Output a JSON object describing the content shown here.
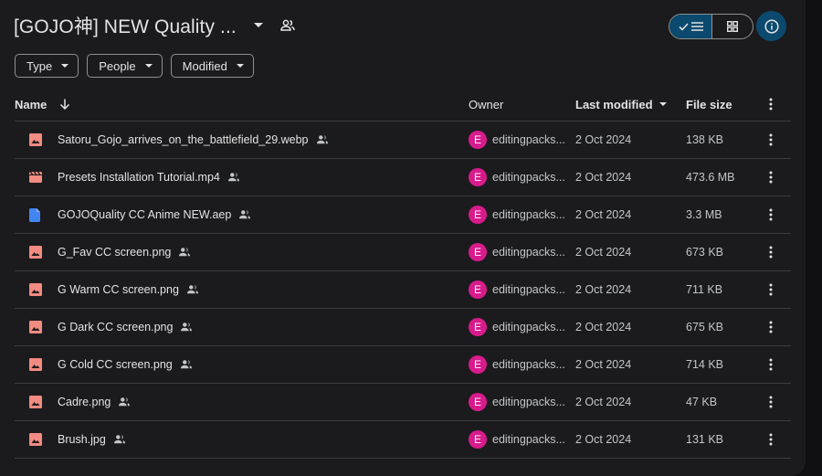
{
  "header": {
    "title": "[GOJO神] NEW Quality ...",
    "colors": {
      "accent": "#0b4a6e",
      "avatar": "#d81b8c",
      "image_icon": "#f28b82",
      "doc_icon": "#4285f4",
      "video_icon": "#f28b82"
    }
  },
  "filters": {
    "type_label": "Type",
    "people_label": "People",
    "modified_label": "Modified"
  },
  "columns": {
    "name": "Name",
    "owner": "Owner",
    "last_modified": "Last modified",
    "file_size": "File size"
  },
  "files": [
    {
      "name": "Satoru_Gojo_arrives_on_the_battlefield_29.webp",
      "icon": "image-icon",
      "owner_initial": "E",
      "owner": "editingpacks...",
      "modified": "2 Oct 2024",
      "size": "138 KB"
    },
    {
      "name": "Presets Installation Tutorial.mp4",
      "icon": "video-icon",
      "owner_initial": "E",
      "owner": "editingpacks...",
      "modified": "2 Oct 2024",
      "size": "473.6 MB"
    },
    {
      "name": "GOJOQuality CC Anime NEW.aep",
      "icon": "doc-icon",
      "owner_initial": "E",
      "owner": "editingpacks...",
      "modified": "2 Oct 2024",
      "size": "3.3 MB"
    },
    {
      "name": "G_Fav CC screen.png",
      "icon": "image-icon",
      "owner_initial": "E",
      "owner": "editingpacks...",
      "modified": "2 Oct 2024",
      "size": "673 KB"
    },
    {
      "name": "G Warm CC screen.png",
      "icon": "image-icon",
      "owner_initial": "E",
      "owner": "editingpacks...",
      "modified": "2 Oct 2024",
      "size": "711 KB"
    },
    {
      "name": "G Dark CC screen.png",
      "icon": "image-icon",
      "owner_initial": "E",
      "owner": "editingpacks...",
      "modified": "2 Oct 2024",
      "size": "675 KB"
    },
    {
      "name": "G Cold CC screen.png",
      "icon": "image-icon",
      "owner_initial": "E",
      "owner": "editingpacks...",
      "modified": "2 Oct 2024",
      "size": "714 KB"
    },
    {
      "name": "Cadre.png",
      "icon": "image-icon",
      "owner_initial": "E",
      "owner": "editingpacks...",
      "modified": "2 Oct 2024",
      "size": "47 KB"
    },
    {
      "name": "Brush.jpg",
      "icon": "image-icon",
      "owner_initial": "E",
      "owner": "editingpacks...",
      "modified": "2 Oct 2024",
      "size": "131 KB"
    }
  ]
}
